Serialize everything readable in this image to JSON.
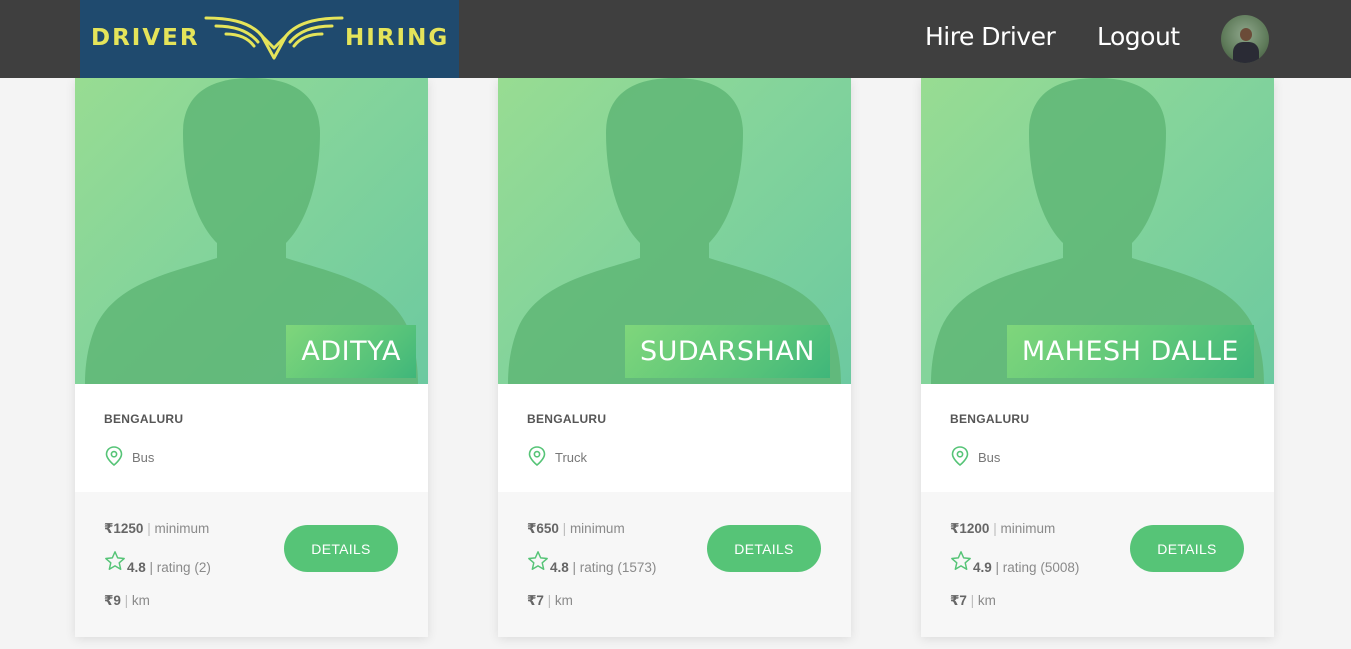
{
  "header": {
    "logo_left": "DRIVER",
    "logo_right": "HIRING",
    "nav": {
      "hire": "Hire Driver",
      "logout": "Logout"
    },
    "colors": {
      "bar": "#3f3f3f",
      "logo_bg": "#1f4a6e",
      "logo_text": "#e5e45a"
    }
  },
  "drivers": [
    {
      "name": "ADITYA",
      "city": "BENGALURU",
      "vehicle": "Bus",
      "price": "₹1250",
      "price_label": "minimum",
      "rating": "4.8",
      "rating_label": "rating (2)",
      "per_km": "₹9",
      "per_km_label": "km",
      "button": "DETAILS"
    },
    {
      "name": "SUDARSHAN",
      "city": "BENGALURU",
      "vehicle": "Truck",
      "price": "₹650",
      "price_label": "minimum",
      "rating": "4.8",
      "rating_label": "rating (1573)",
      "per_km": "₹7",
      "per_km_label": "km",
      "button": "DETAILS"
    },
    {
      "name": "MAHESH DALLE",
      "city": "BENGALURU",
      "vehicle": "Bus",
      "price": "₹1200",
      "price_label": "minimum",
      "rating": "4.9",
      "rating_label": "rating (5008)",
      "per_km": "₹7",
      "per_km_label": "km",
      "button": "DETAILS"
    }
  ],
  "accent": "#56c477"
}
